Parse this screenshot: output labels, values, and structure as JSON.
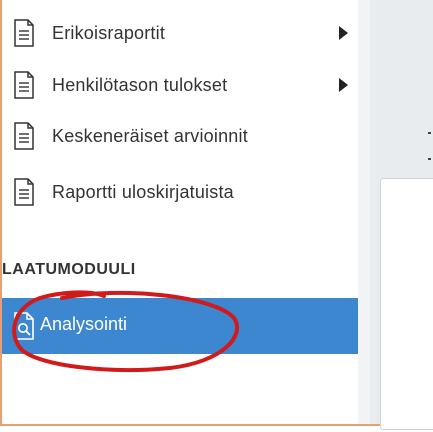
{
  "menu": {
    "items": [
      {
        "label": "Erikoisraportit",
        "icon": "document-icon",
        "has_submenu": true
      },
      {
        "label": "Henkilötason tulokset",
        "icon": "document-icon",
        "has_submenu": true
      },
      {
        "label": "Keskeneräiset arvioinnit",
        "icon": "document-icon",
        "has_submenu": false
      },
      {
        "label": "Raportti uloskirjatuista",
        "icon": "document-icon",
        "has_submenu": false
      }
    ],
    "section_heading": "LAATUMODUULI",
    "active_item": {
      "label": "Analysointi",
      "icon": "document-search-icon"
    }
  },
  "colors": {
    "active_bg": "#3d86d0",
    "annotation": "#d11a1a",
    "frame_border": "#e8a070",
    "main_bg": "#e9ecef"
  }
}
